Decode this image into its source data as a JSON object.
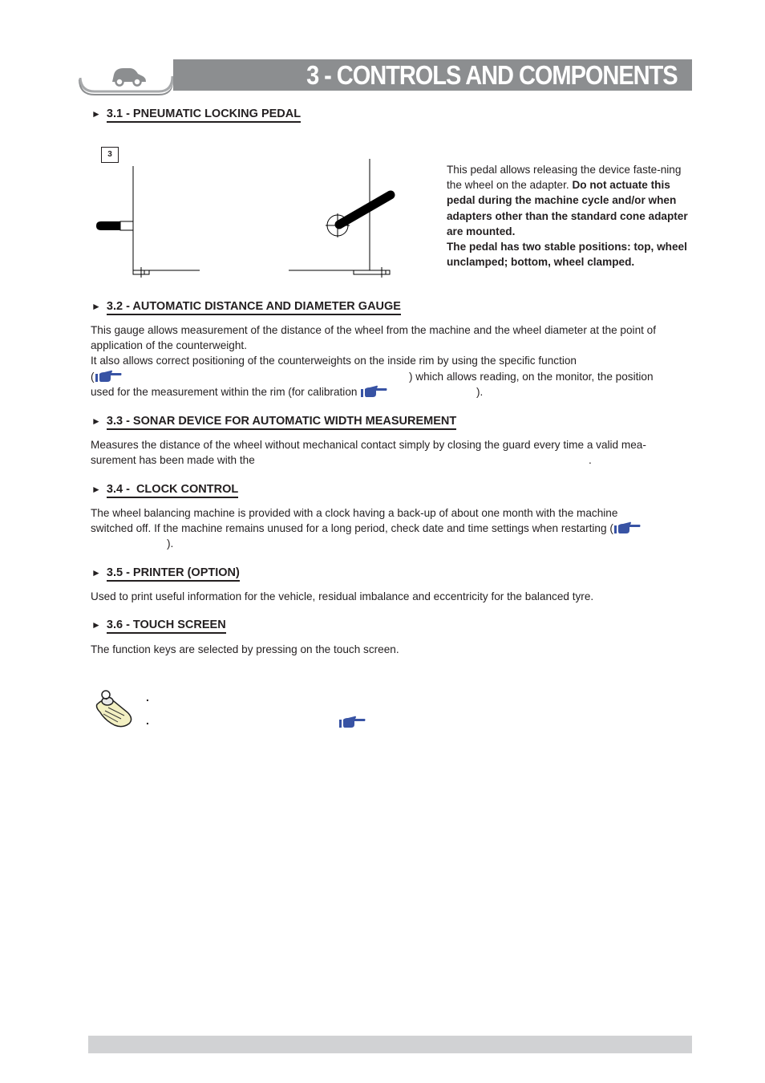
{
  "header": {
    "title": "3 - CONTROLS AND COMPONENTS",
    "tab_icon": "car-icon",
    "bar_color": "#8c8e90"
  },
  "figure": {
    "label": "3",
    "icons": [
      "pedal-up-drawing",
      "pedal-down-drawing"
    ]
  },
  "sections": [
    {
      "heading": "3.1 - PNEUMATIC LOCKING PEDAL",
      "text_normal": "This pedal allows releasing the device faste-ning the wheel on the adapter. ",
      "text_bold_1": "Do not actuate this pedal during the machine cycle and/or when adapters other than the standard cone adapter are mounted.",
      "text_bold_2": "The pedal has two stable positions: top, wheel unclamped; bottom, wheel clamped."
    },
    {
      "heading": "3.2 - AUTOMATIC DISTANCE AND DIAMETER GAUGE",
      "line1": "This gauge allows measurement of the distance of the wheel from the machine and the wheel diameter at the point of",
      "line2": "application of the counterweight.",
      "line3": "It also allows correct positioning of the counterweights on the inside rim by using the specific function",
      "line4_open": "(",
      "line4_close": ") which allows reading, on the monitor, the position",
      "line5_start": "used for the measurement within the rim (for calibration ",
      "line5_end": ")."
    },
    {
      "heading": "3.3 - SONAR DEVICE FOR AUTOMATIC WIDTH MEASUREMENT",
      "line1": "Measures the distance of the wheel without mechanical contact simply by closing the guard every time a valid mea-",
      "line2": "surement has been made with the",
      "line2_end": "."
    },
    {
      "heading": "3.4 -  CLOCK CONTROL",
      "line1": "The wheel balancing machine is provided with a clock having a back-up of about one month with the machine",
      "line2": "switched off. If the machine remains unused for a long period, check date and time settings when restarting (",
      "line3": ")."
    },
    {
      "heading": "3.5 - PRINTER (OPTION)",
      "line1": "Used to print useful information for the vehicle, residual imbalance and eccentricity for the balanced tyre."
    },
    {
      "heading": "3.6 - TOUCH SCREEN",
      "line1": "The function keys are selected by pressing on the touch screen."
    }
  ],
  "note": {
    "icon": "note-pin-icon",
    "bullets": [
      ".",
      "."
    ],
    "ref_icon": "pointing-hand-icon"
  },
  "arrow_glyph": "►",
  "accent_colors": {
    "hand_icon": "#3853a4",
    "footer_bar": "#d1d2d4"
  }
}
